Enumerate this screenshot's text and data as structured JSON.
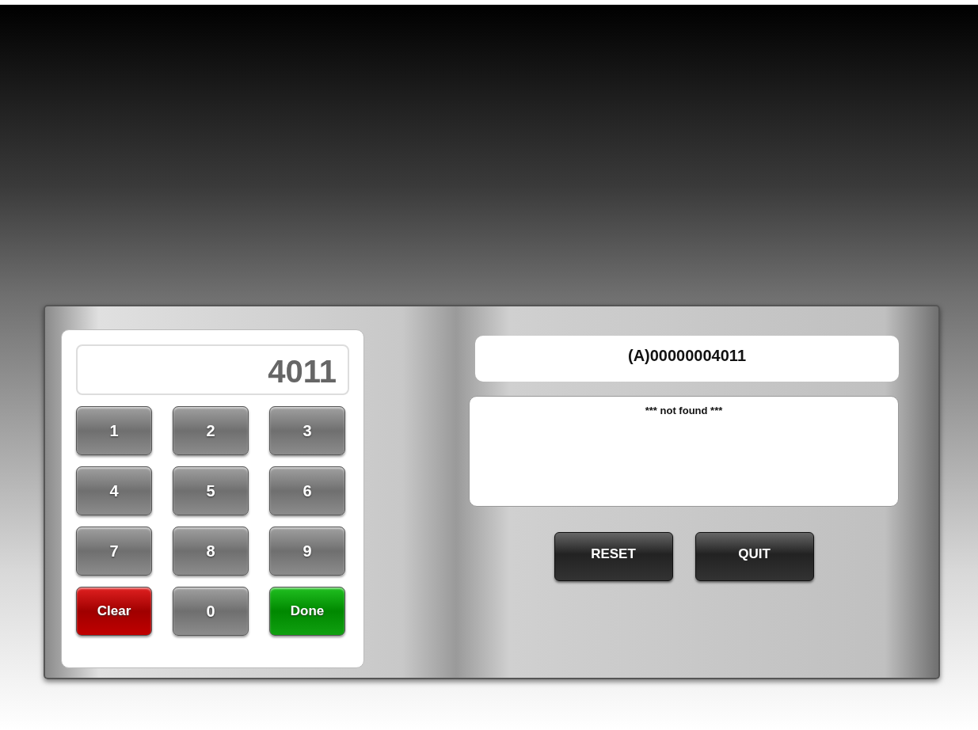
{
  "keypad": {
    "display": "4011",
    "keys": [
      {
        "label": "1",
        "kind": "digit"
      },
      {
        "label": "2",
        "kind": "digit"
      },
      {
        "label": "3",
        "kind": "digit"
      },
      {
        "label": "4",
        "kind": "digit"
      },
      {
        "label": "5",
        "kind": "digit"
      },
      {
        "label": "6",
        "kind": "digit"
      },
      {
        "label": "7",
        "kind": "digit"
      },
      {
        "label": "8",
        "kind": "digit"
      },
      {
        "label": "9",
        "kind": "digit"
      },
      {
        "label": "Clear",
        "kind": "clear"
      },
      {
        "label": "0",
        "kind": "digit"
      },
      {
        "label": "Done",
        "kind": "done"
      }
    ]
  },
  "lookup": {
    "code": "(A)00000004011",
    "message": "*** not found ***"
  },
  "buttons": [
    "RESET",
    "QUIT"
  ]
}
